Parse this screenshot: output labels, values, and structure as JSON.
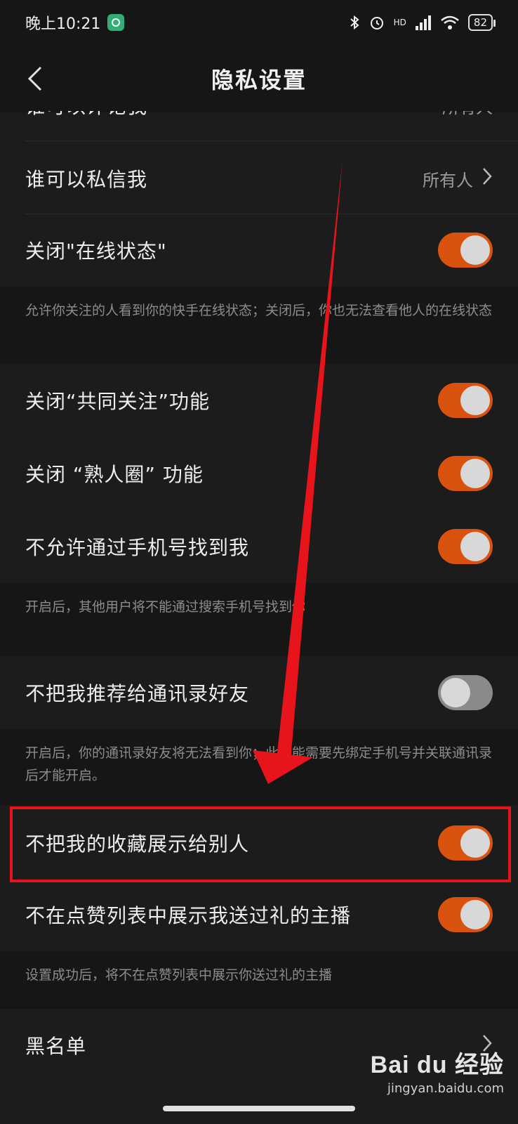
{
  "status_bar": {
    "time": "晚上10:21",
    "network": "HD",
    "battery": "82"
  },
  "header": {
    "title": "隐私设置"
  },
  "partial_row": {
    "label": "谁可以评论我",
    "value": "所有人"
  },
  "rows": [
    {
      "label": "谁可以私信我",
      "value": "所有人"
    },
    {
      "label": "关闭\"在线状态\"",
      "toggle": "on"
    },
    {
      "label": "关闭“共同关注”功能",
      "toggle": "on"
    },
    {
      "label": "关闭 “熟人圈” 功能",
      "toggle": "on"
    },
    {
      "label": "不允许通过手机号找到我",
      "toggle": "on"
    },
    {
      "label": "不把我推荐给通讯录好友",
      "toggle": "off"
    },
    {
      "label": "不把我的收藏展示给别人",
      "toggle": "on"
    },
    {
      "label": "不在点赞列表中展示我送过礼的主播",
      "toggle": "on"
    },
    {
      "label": "黑名单"
    }
  ],
  "descriptions": {
    "online_status": "允许你关注的人看到你的快手在线状态；关闭后，你也无法查看他人的在线状态",
    "phone_search": "开启后，其他用户将不能通过搜索手机号找到你",
    "contacts": "开启后，你的通讯录好友将无法看到你；此功能需要先绑定手机号并关联通讯录后才能开启。",
    "gift_anchor": "设置成功后，将不在点赞列表中展示你送过礼的主播"
  },
  "watermark": {
    "main": "Bai du 经验",
    "sub": "jingyan.baidu.com"
  },
  "colors": {
    "toggle_on": "#d9530f",
    "toggle_off": "#8a8a8a",
    "annotation": "#e8141b"
  }
}
